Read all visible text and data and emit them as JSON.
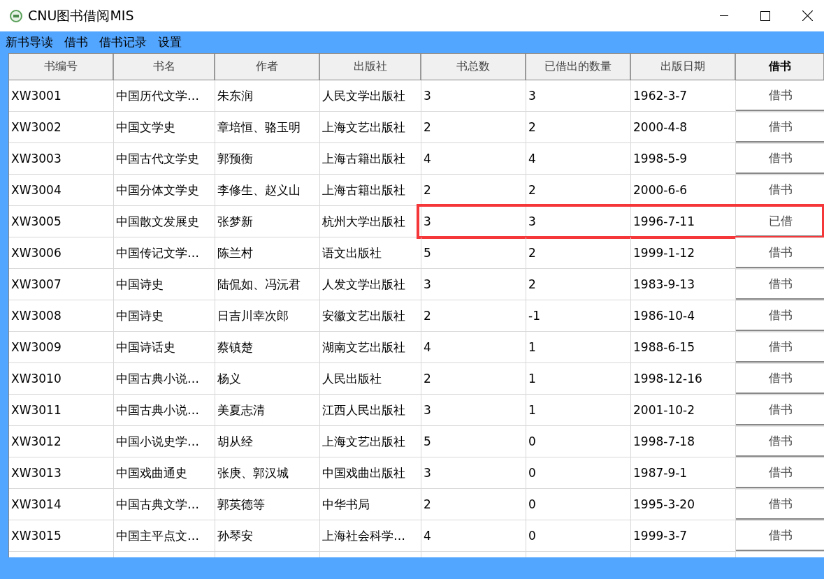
{
  "window": {
    "title": "CNU图书借阅MIS"
  },
  "menu": [
    "新书导读",
    "借书",
    "借书记录",
    "设置"
  ],
  "table": {
    "columns": [
      "书编号",
      "书名",
      "作者",
      "出版社",
      "书总数",
      "已借出的数量",
      "出版日期",
      "借书"
    ],
    "rows": [
      {
        "cells": [
          "XW3001",
          "中国历代文学…",
          "朱东润",
          "人民文学出版社",
          "3",
          "3",
          "1962-3-7"
        ],
        "action": "借书",
        "highlighted": false
      },
      {
        "cells": [
          "XW3002",
          "中国文学史",
          "章培恒、骆玉明",
          "上海文艺出版社",
          "2",
          "2",
          "2000-4-8"
        ],
        "action": "借书",
        "highlighted": false
      },
      {
        "cells": [
          "XW3003",
          "中国古代文学史",
          "郭预衡",
          "上海古籍出版社",
          "4",
          "4",
          "1998-5-9"
        ],
        "action": "借书",
        "highlighted": false
      },
      {
        "cells": [
          "XW3004",
          "中国分体文学史",
          "李修生、赵义山",
          "上海古籍出版社",
          "2",
          "2",
          "2000-6-6"
        ],
        "action": "借书",
        "highlighted": false
      },
      {
        "cells": [
          "XW3005",
          "中国散文发展史",
          "张梦新",
          "杭州大学出版社",
          "3",
          "3",
          "1996-7-11"
        ],
        "action": "已借",
        "highlighted": true
      },
      {
        "cells": [
          "XW3006",
          "中国传记文学…",
          "陈兰村",
          "语文出版社",
          "5",
          "2",
          "1999-1-12"
        ],
        "action": "借书",
        "highlighted": false
      },
      {
        "cells": [
          "XW3007",
          "中国诗史",
          "陆侃如、冯沅君",
          "人发文学出版社",
          "3",
          "2",
          "1983-9-13"
        ],
        "action": "借书",
        "highlighted": false
      },
      {
        "cells": [
          "XW3008",
          "中国诗史",
          "日吉川幸次郎",
          "安徽文艺出版社",
          "2",
          "-1",
          "1986-10-4"
        ],
        "action": "借书",
        "highlighted": false
      },
      {
        "cells": [
          "XW3009",
          "中国诗话史",
          "蔡镇楚",
          "湖南文艺出版社",
          "4",
          "1",
          "1988-6-15"
        ],
        "action": "借书",
        "highlighted": false
      },
      {
        "cells": [
          "XW3010",
          "中国古典小说…",
          "杨义",
          "人民出版社",
          "2",
          "1",
          "1998-12-16"
        ],
        "action": "借书",
        "highlighted": false
      },
      {
        "cells": [
          "XW3011",
          "中国古典小说…",
          "美夏志清",
          "江西人民出版社",
          "3",
          "1",
          "2001-10-2"
        ],
        "action": "借书",
        "highlighted": false
      },
      {
        "cells": [
          "XW3012",
          "中国小说史学…",
          "胡从经",
          "上海文艺出版社",
          "5",
          "0",
          "1998-7-18"
        ],
        "action": "借书",
        "highlighted": false
      },
      {
        "cells": [
          "XW3013",
          "中国戏曲通史",
          "张庚、郭汉城",
          "中国戏曲出版社",
          "3",
          "0",
          "1987-9-1"
        ],
        "action": "借书",
        "highlighted": false
      },
      {
        "cells": [
          "XW3014",
          "中国古典文学…",
          "郭英德等",
          "中华书局",
          "2",
          "0",
          "1995-3-20"
        ],
        "action": "借书",
        "highlighted": false
      },
      {
        "cells": [
          "XW3015",
          "中国主平点文…",
          "孙琴安",
          "上海社会科学…",
          "4",
          "0",
          "1999-3-7"
        ],
        "action": "借书",
        "highlighted": false
      }
    ]
  }
}
